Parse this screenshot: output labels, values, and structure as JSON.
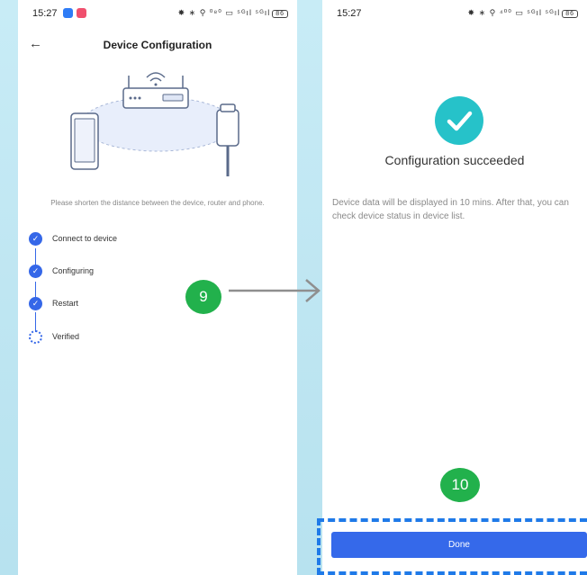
{
  "left_screen": {
    "status_time": "15:27",
    "status_icons": "✸ ∗ ⚲ ⁰⁸⁰ ▭ ⁵ᴳıl ⁵ᴳıl",
    "battery": "86",
    "title": "Device Configuration",
    "hint": "Please shorten the distance between the device, router and phone.",
    "steps": [
      {
        "label": "Connect to device",
        "state": "done"
      },
      {
        "label": "Configuring",
        "state": "done"
      },
      {
        "label": "Restart",
        "state": "done"
      },
      {
        "label": "Verified",
        "state": "loading"
      }
    ]
  },
  "right_screen": {
    "status_time": "15:27",
    "status_icons": "✸ ∗ ⚲ ⁴⁰⁰ ▭ ⁵ᴳıl ⁵ᴳıl",
    "battery": "86",
    "success_title": "Configuration succeeded",
    "description": "Device data will be displayed in 10 mins. After that, you can check device status in device list.",
    "done_label": "Done"
  },
  "annotations": {
    "step_9": "9",
    "step_10": "10"
  },
  "colors": {
    "accent_blue": "#3567e8",
    "success_teal": "#26c2c9",
    "badge_green": "#22b14c",
    "background": "#c8ecf6"
  },
  "icons": [
    "back-arrow-icon",
    "router-icon",
    "phone-icon",
    "inverter-icon",
    "check-icon",
    "spinner-icon",
    "arrow-right-icon"
  ]
}
